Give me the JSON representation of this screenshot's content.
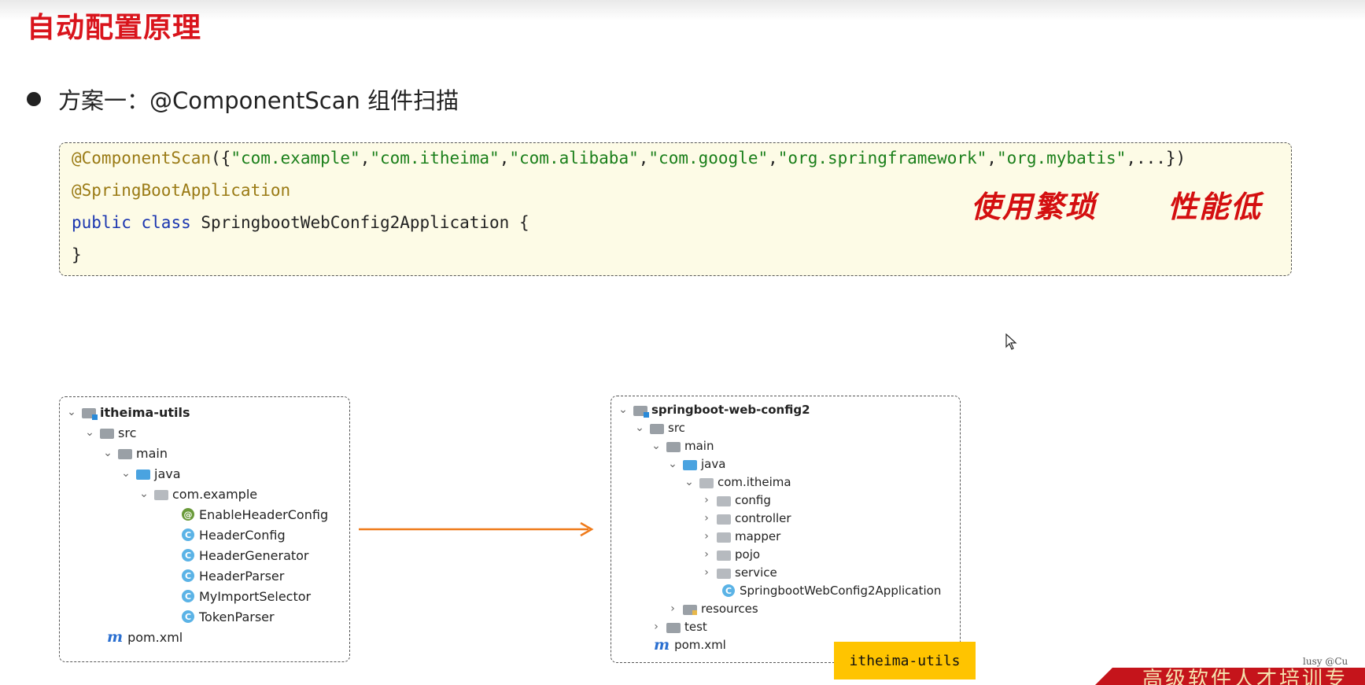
{
  "slide": {
    "title": "自动配置原理",
    "bullet": "方案一：@ComponentScan 组件扫描"
  },
  "code": {
    "line1_annotation": "@ComponentScan",
    "line1_open": "({",
    "line1_strings": [
      "\"com.example\"",
      "\"com.itheima\"",
      "\"com.alibaba\"",
      "\"com.google\"",
      "\"org.springframework\"",
      "\"org.mybatis\""
    ],
    "line1_close": ",...})",
    "line2": "@SpringBootApplication",
    "line3_kw1": "public",
    "line3_kw2": "class",
    "line3_rest": " SpringbootWebConfig2Application {",
    "line4": "}"
  },
  "handwritten_notes": [
    "使用繁琐",
    "性能低"
  ],
  "tree_left": {
    "root": "itheima-utils",
    "src": "src",
    "main": "main",
    "java": "java",
    "package": "com.example",
    "items": [
      {
        "icon": "annotation-icon",
        "label": "EnableHeaderConfig"
      },
      {
        "icon": "class-icon",
        "label": "HeaderConfig"
      },
      {
        "icon": "class-icon",
        "label": "HeaderGenerator"
      },
      {
        "icon": "class-icon",
        "label": "HeaderParser"
      },
      {
        "icon": "class-icon",
        "label": "MyImportSelector"
      },
      {
        "icon": "class-icon",
        "label": "TokenParser"
      }
    ],
    "pom": "pom.xml"
  },
  "tree_right": {
    "root": "springboot-web-config2",
    "src": "src",
    "main": "main",
    "java": "java",
    "package": "com.itheima",
    "subpackages": [
      "config",
      "controller",
      "mapper",
      "pojo",
      "service"
    ],
    "app_class": "SpringbootWebConfig2Application",
    "resources": "resources",
    "test": "test",
    "pom": "pom.xml"
  },
  "tag": "itheima-utils",
  "watermark": "lusy @Cu",
  "banner": "高级软件人才培训专",
  "colors": {
    "title": "#d9141c",
    "annotation": "#9a7a14",
    "string": "#1a7f1a",
    "keyword": "#1a35b0",
    "arrow": "#ef7a1a",
    "tag_bg": "#ffc400"
  }
}
